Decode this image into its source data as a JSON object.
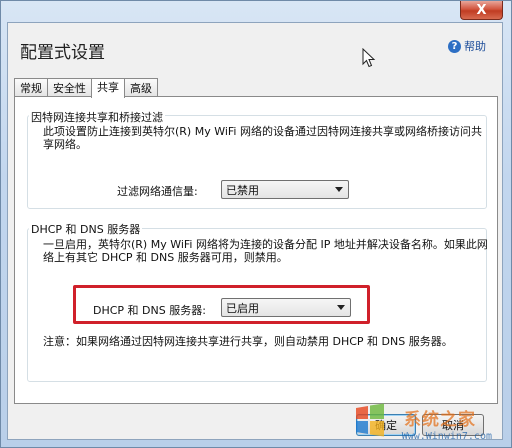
{
  "window": {
    "title": "配置式设置",
    "close_glyph": "X",
    "help_label": "帮助",
    "help_glyph": "?"
  },
  "tabs": [
    {
      "label": "常规",
      "active": false
    },
    {
      "label": "安全性",
      "active": false
    },
    {
      "label": "共享",
      "active": true
    },
    {
      "label": "高级",
      "active": false
    }
  ],
  "sharing_group": {
    "heading": "因特网连接共享和桥接过滤",
    "description": "此项设置防止连接到英特尔(R) My WiFi 网络的设备通过因特网连接共享或网络桥接访问共享网络。",
    "filter_label": "过滤网络通信量:",
    "filter_value": "已禁用"
  },
  "dhcp_group": {
    "heading": "DHCP 和 DNS 服务器",
    "description": "一旦启用，英特尔(R) My WiFi 网络将为连接的设备分配 IP 地址并解决设备名称。如果此网络上有其它 DHCP 和 DNS 服务器可用，则禁用。",
    "server_label": "DHCP 和 DNS 服务器:",
    "server_value": "已启用",
    "note": "注意：如果网络通过因特网连接共享进行共享，则自动禁用 DHCP 和 DNS 服务器。"
  },
  "buttons": {
    "ok": "确定",
    "cancel": "取消"
  },
  "watermark": {
    "text": "系统之家",
    "url": "Www.Winwin7.com",
    "logo_letters": "Win7"
  },
  "colors": {
    "highlight": "#d0202a",
    "close": "#c03c22",
    "help": "#1e4e9a"
  }
}
